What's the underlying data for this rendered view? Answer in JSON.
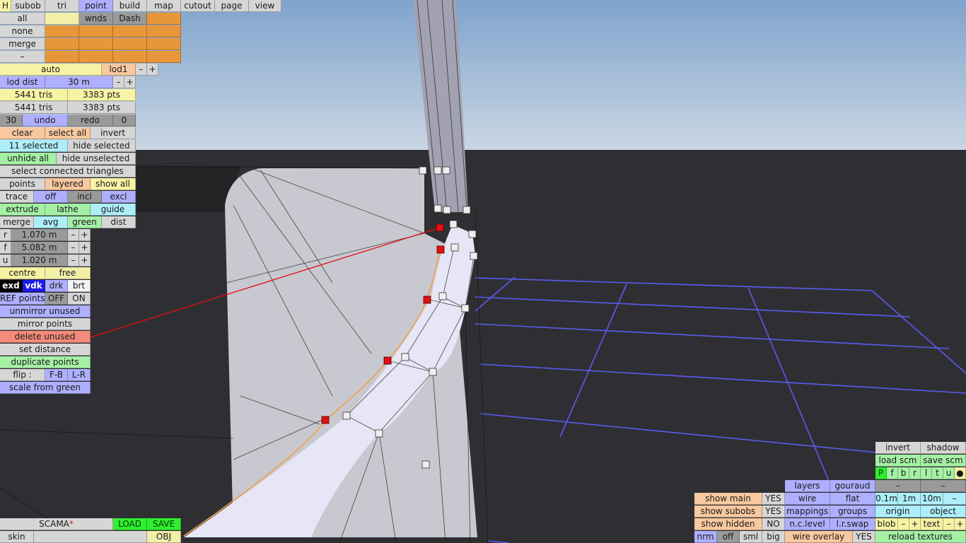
{
  "top_tabs": [
    "H",
    "subob",
    "tri",
    "point",
    "build",
    "map",
    "cutout",
    "page",
    "view"
  ],
  "sel": {
    "all": "all",
    "wnds": "wnds",
    "dash": "Dash",
    "none": "none",
    "merge": "merge",
    "minus": "–"
  },
  "lod": {
    "auto": "auto",
    "lod1": "lod1",
    "minus": "–",
    "plus": "+",
    "dist_label": "lod dist",
    "dist_value": "30 m"
  },
  "stats": {
    "tris1": "5441 tris",
    "pts1": "3383 pts",
    "tris2": "5441 tris",
    "pts2": "3383 pts"
  },
  "undo": {
    "count": "30",
    "undo": "undo",
    "redo": "redo",
    "redo_count": "0"
  },
  "select": {
    "clear": "clear",
    "select_all": "select all",
    "invert": "invert",
    "selected": "11 selected",
    "hide_selected": "hide selected",
    "unhide_all": "unhide all",
    "hide_unselected": "hide unselected",
    "select_connected": "select connected triangles"
  },
  "modes": {
    "points": "points",
    "layered": "layered",
    "show_all": "show all",
    "trace": "trace",
    "off": "off",
    "incl": "incl",
    "excl": "excl",
    "extrude": "extrude",
    "lathe": "lathe",
    "guide": "guide",
    "merge": "merge",
    "avg": "avg",
    "green": "green",
    "dist": "dist"
  },
  "params": [
    {
      "label": "r",
      "value": "1.070 m"
    },
    {
      "label": "f",
      "value": "5.082 m"
    },
    {
      "label": "u",
      "value": "1.020 m"
    }
  ],
  "pm": {
    "minus": "–",
    "plus": "+"
  },
  "pivot": {
    "centre": "centre",
    "free": "free"
  },
  "shade": {
    "exd": "exd",
    "vdk": "vdk",
    "drk": "drk",
    "brt": "brt"
  },
  "ref": {
    "label": "REF points",
    "off": "OFF",
    "on": "ON"
  },
  "ops": {
    "unmirror": "unmirror unused",
    "mirror": "mirror points",
    "delete": "delete unused",
    "set_distance": "set distance",
    "duplicate": "duplicate points",
    "flip": "flip :",
    "fb": "F-B",
    "lr": "L-R",
    "scale": "scale from green"
  },
  "file": {
    "name": "SCAMA",
    "star": "*",
    "load": "LOAD",
    "save": "SAVE",
    "skin": "skin",
    "obj": "OBJ"
  },
  "right": {
    "invert": "invert",
    "shadow": "shadow",
    "load_scm": "load scm",
    "save_scm": "save scm",
    "letters": [
      "P",
      "f",
      "b",
      "r",
      "l",
      "t",
      "u",
      "●"
    ],
    "dash1": "–",
    "dash2": "–",
    "layers": "layers",
    "gouraud": "gouraud",
    "wire": "wire",
    "flat": "flat",
    "s01": "0.1m",
    "s1": "1m",
    "s10": "10m",
    "sminus": "–",
    "show_main": "show main",
    "yes1": "YES",
    "mappings": "mappings",
    "groups": "groups",
    "origin": "origin",
    "object": "object",
    "show_subobs": "show subobs",
    "yes2": "YES",
    "nclevel": "n.c.level",
    "lrswap": "l.r.swap",
    "blob": "blob",
    "text": "text",
    "minus": "–",
    "plus": "+",
    "show_hidden": "show hidden",
    "no": "NO",
    "nrm": "nrm",
    "off": "off",
    "sml": "sml",
    "big": "big",
    "wire_overlay": "wire overlay",
    "yes3": "YES",
    "reload": "reload textures"
  }
}
